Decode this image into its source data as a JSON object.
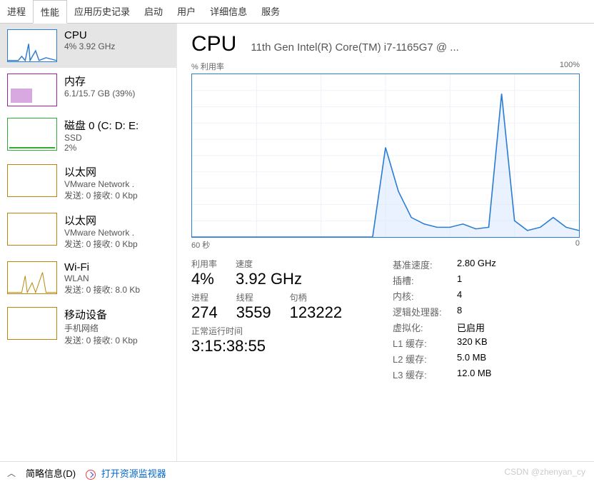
{
  "tabs": [
    "进程",
    "性能",
    "应用历史记录",
    "启动",
    "用户",
    "详细信息",
    "服务"
  ],
  "active_tab": 1,
  "sidebar": [
    {
      "title": "CPU",
      "sub": "4% 3.92 GHz",
      "color": "#2b7cd3"
    },
    {
      "title": "内存",
      "sub": "6.1/15.7 GB (39%)",
      "color": "#a020a0"
    },
    {
      "title": "磁盘 0 (C: D: E:",
      "sub": "SSD",
      "sub2": "2%",
      "color": "#3a3"
    },
    {
      "title": "以太网",
      "sub": "VMware Network .",
      "sub2": "发送: 0 接收: 0 Kbp",
      "color": "#b8860b"
    },
    {
      "title": "以太网",
      "sub": "VMware Network .",
      "sub2": "发送: 0 接收: 0 Kbp",
      "color": "#b8860b"
    },
    {
      "title": "Wi-Fi",
      "sub": "WLAN",
      "sub2": "发送: 0 接收: 8.0 Kb",
      "color": "#b8860b"
    },
    {
      "title": "移动设备",
      "sub": "手机网络",
      "sub2": "发送: 0 接收: 0 Kbp",
      "color": "#b8860b"
    }
  ],
  "main": {
    "title": "CPU",
    "subtitle": "11th Gen Intel(R) Core(TM) i7-1165G7 @ ...",
    "ylabel": "% 利用率",
    "ymax": "100%",
    "xlabel_left": "60 秒",
    "xlabel_right": "0",
    "stats_left": [
      {
        "label": "利用率",
        "val": "4%"
      },
      {
        "label": "速度",
        "val": "3.92 GHz"
      }
    ],
    "stats_left2": [
      {
        "label": "进程",
        "val": "274"
      },
      {
        "label": "线程",
        "val": "3559"
      },
      {
        "label": "句柄",
        "val": "123222"
      }
    ],
    "uptime_label": "正常运行时间",
    "uptime": "3:15:38:55",
    "stats_right": [
      {
        "k": "基准速度:",
        "v": "2.80 GHz"
      },
      {
        "k": "插槽:",
        "v": "1"
      },
      {
        "k": "内核:",
        "v": "4"
      },
      {
        "k": "逻辑处理器:",
        "v": "8"
      },
      {
        "k": "虚拟化:",
        "v": "已启用"
      },
      {
        "k": "L1 缓存:",
        "v": "320 KB"
      },
      {
        "k": "L2 缓存:",
        "v": "5.0 MB"
      },
      {
        "k": "L3 缓存:",
        "v": "12.0 MB"
      }
    ]
  },
  "footer": {
    "brief": "简略信息(D)",
    "resmon": "打开资源监视器"
  },
  "watermark": "CSDN @zhenyan_cy",
  "chart_data": {
    "type": "line",
    "title": "% 利用率",
    "xlabel": "60 秒",
    "ylabel": "% 利用率",
    "ylim": [
      0,
      100
    ],
    "x_seconds_ago": [
      60,
      58,
      56,
      54,
      52,
      50,
      48,
      46,
      44,
      42,
      40,
      38,
      36,
      34,
      32,
      30,
      28,
      26,
      24,
      22,
      20,
      18,
      16,
      14,
      12,
      10,
      8,
      6,
      4,
      2,
      0
    ],
    "values": [
      0,
      0,
      0,
      0,
      0,
      0,
      0,
      0,
      0,
      0,
      0,
      0,
      0,
      0,
      0,
      55,
      28,
      12,
      8,
      6,
      6,
      8,
      5,
      6,
      88,
      10,
      4,
      6,
      12,
      6,
      4
    ]
  }
}
